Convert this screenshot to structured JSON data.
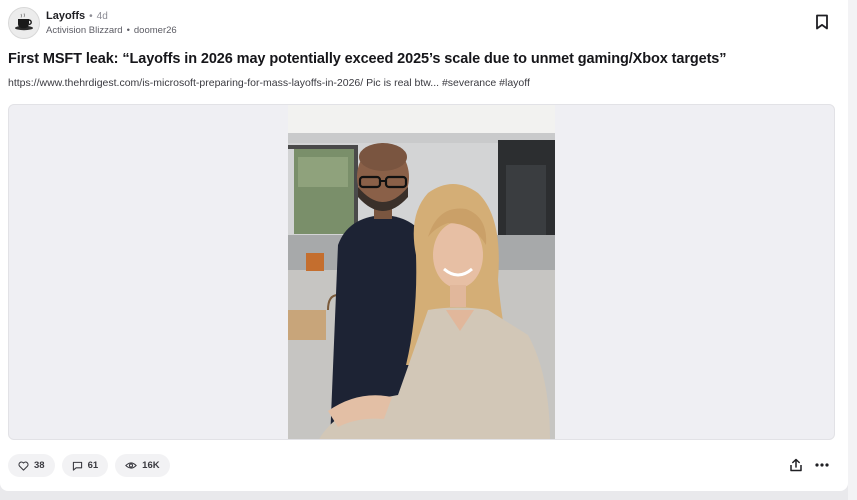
{
  "post": {
    "channel": "Layoffs",
    "separator": "•",
    "age": "4d",
    "company": "Activision Blizzard",
    "author": "doomer26",
    "title": "First MSFT leak: “Layoffs in 2026 may potentially exceed 2025’s scale due to unmet gaming/Xbox targets”",
    "description": "https://www.thehrdigest.com/is-microsoft-preparing-for-mass-layoffs-in-2026/  Pic is real btw...  #severance #layoff"
  },
  "actions": {
    "likes": "38",
    "comments": "61",
    "views": "16K"
  },
  "icons": {
    "avatar": "coffee-cup-avatar",
    "bookmark": "bookmark-icon",
    "like": "heart-icon",
    "comment": "comment-icon",
    "views": "eye-icon",
    "share": "share-icon",
    "more": "more-icon"
  },
  "colors": {
    "card": "#ffffff",
    "media_background": "#efeff3",
    "pill_background": "#f2f2f4",
    "text_primary": "#16161a",
    "text_secondary": "#5c5c64"
  }
}
